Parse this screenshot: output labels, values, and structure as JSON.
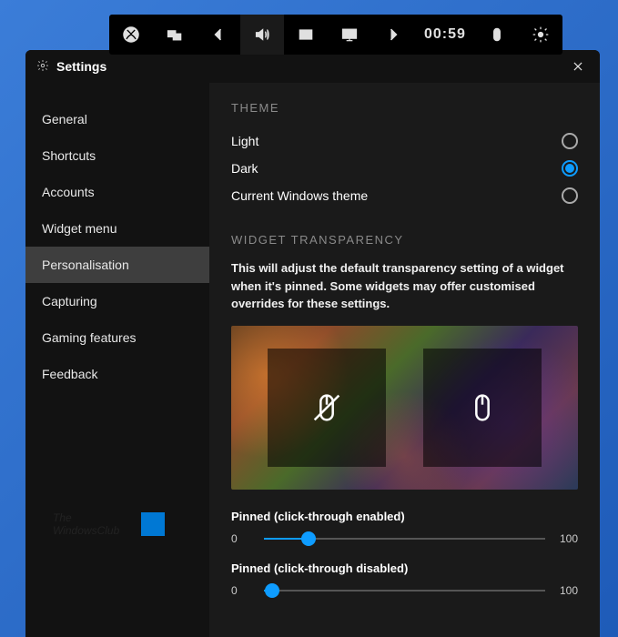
{
  "topbar": {
    "clock": "00:59"
  },
  "panel": {
    "title": "Settings"
  },
  "sidebar": {
    "items": [
      {
        "label": "General"
      },
      {
        "label": "Shortcuts"
      },
      {
        "label": "Accounts"
      },
      {
        "label": "Widget menu"
      },
      {
        "label": "Personalisation",
        "selected": true
      },
      {
        "label": "Capturing"
      },
      {
        "label": "Gaming features"
      },
      {
        "label": "Feedback"
      }
    ]
  },
  "watermark": {
    "line1": "The",
    "line2": "WindowsClub"
  },
  "theme_section": {
    "title": "THEME",
    "options": [
      {
        "label": "Light",
        "selected": false
      },
      {
        "label": "Dark",
        "selected": true
      },
      {
        "label": "Current Windows theme",
        "selected": false
      }
    ]
  },
  "transparency_section": {
    "title": "WIDGET TRANSPARENCY",
    "description": "This will adjust the default transparency setting of a widget when it's pinned. Some widgets may offer customised overrides for these settings."
  },
  "sliders": {
    "first": {
      "label": "Pinned (click-through enabled)",
      "min": "0",
      "max": "100",
      "value": 16
    },
    "second": {
      "label": "Pinned (click-through disabled)",
      "min": "0",
      "max": "100",
      "value": 3
    }
  }
}
